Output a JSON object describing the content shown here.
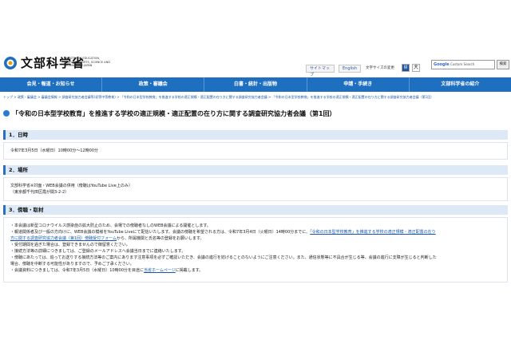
{
  "logo": {
    "name": "文部科学省",
    "en": "MINISTRY OF EDUCATION, CULTURE, SPORTS, SCIENCE AND TECHNOLOGY-JAPAN"
  },
  "util": {
    "sitemap": "サイトマップ",
    "english": "English",
    "fontsize_label": "文字サイズの変更",
    "fs_std": "標",
    "fs_big": "大"
  },
  "search": {
    "google": "Google",
    "placeholder": "Custom Search",
    "button": "検索"
  },
  "gnav": [
    "会見・報道・お知らせ",
    "政策・審議会",
    "白書・統計・出版物",
    "申請・手続き",
    "文部科学省の紹介"
  ],
  "breadcrumb": "トップ > 政策・審議会 > 審議会情報 > 調査研究協力者会議等(初等中等教育) > 「令和の日本型学校教育」を推進する学校の適正規模・適正配置の在り方に関する調査研究協力者会議 > 「令和の日本型学校教育」を推進する学校の適正規模・適正配置の在り方に関する調査研究協力者会議（第1回）",
  "page_title": "「令和の日本型学校教育」を推進する学校の適正規模・適正配置の在り方に関する調査研究協力者会議（第1回）",
  "sections": {
    "s1": {
      "heading": "1．日時",
      "line1": "令和7年3月5日（水曜日）10時00分～12時00分"
    },
    "s2": {
      "heading": "2．場所",
      "line1": "文部科学省※対面・WEB会議の併用（傍聴はYouTube Live上のみ）",
      "line2": "（東京都千代田区霞が関3-2-2）"
    },
    "s3": {
      "heading": "3．傍聴・取材",
      "line1": "・本会議は新型コロナウイルス感染症の拡大防止のため、会場での傍聴者なしのWEB会議による開催とします。",
      "line2a": "・報道関係者及び一般の方向けに、WEB会議の模様をYouTube Liveにて配信いたします。会議の傍聴を希望される方は、令和7年3月4日（火曜日）14時00分までに、",
      "link1": "「令和の日本型学校教育」を推進する学校の適正規模・適正配置の在り",
      "line3a": "方に関する調査研究協力者会議（第1回）傍聴受付フォーム",
      "line3b": "から、所属機関と氏名等の登録をお願いします。",
      "line4": "・受付期間を過ぎた場合は、登録できませんので御留意ください。",
      "line5": "・接続方法等の詳細につきましては、ご登録のメールアドレスへ会議当日までに連絡いたします。",
      "line6": "・傍聴にあたっては、追ってお送りする接続方法等のご案内にあります注意事項を必ずご確認いただき、会議の進行を妨げることのないようにご注意ください。また、通信状態等に不具合が生じる等、会議の進行に支障が生じると判断した",
      "line7": "場合、傍聴を中断する可能性がありますので、予めご了承ください。",
      "line8a": "・会議資料につきましては、令和7年3月5日（水曜日）10時00分を目途に",
      "link2": "当省ホームページ",
      "line8b": "に掲載します。"
    }
  }
}
